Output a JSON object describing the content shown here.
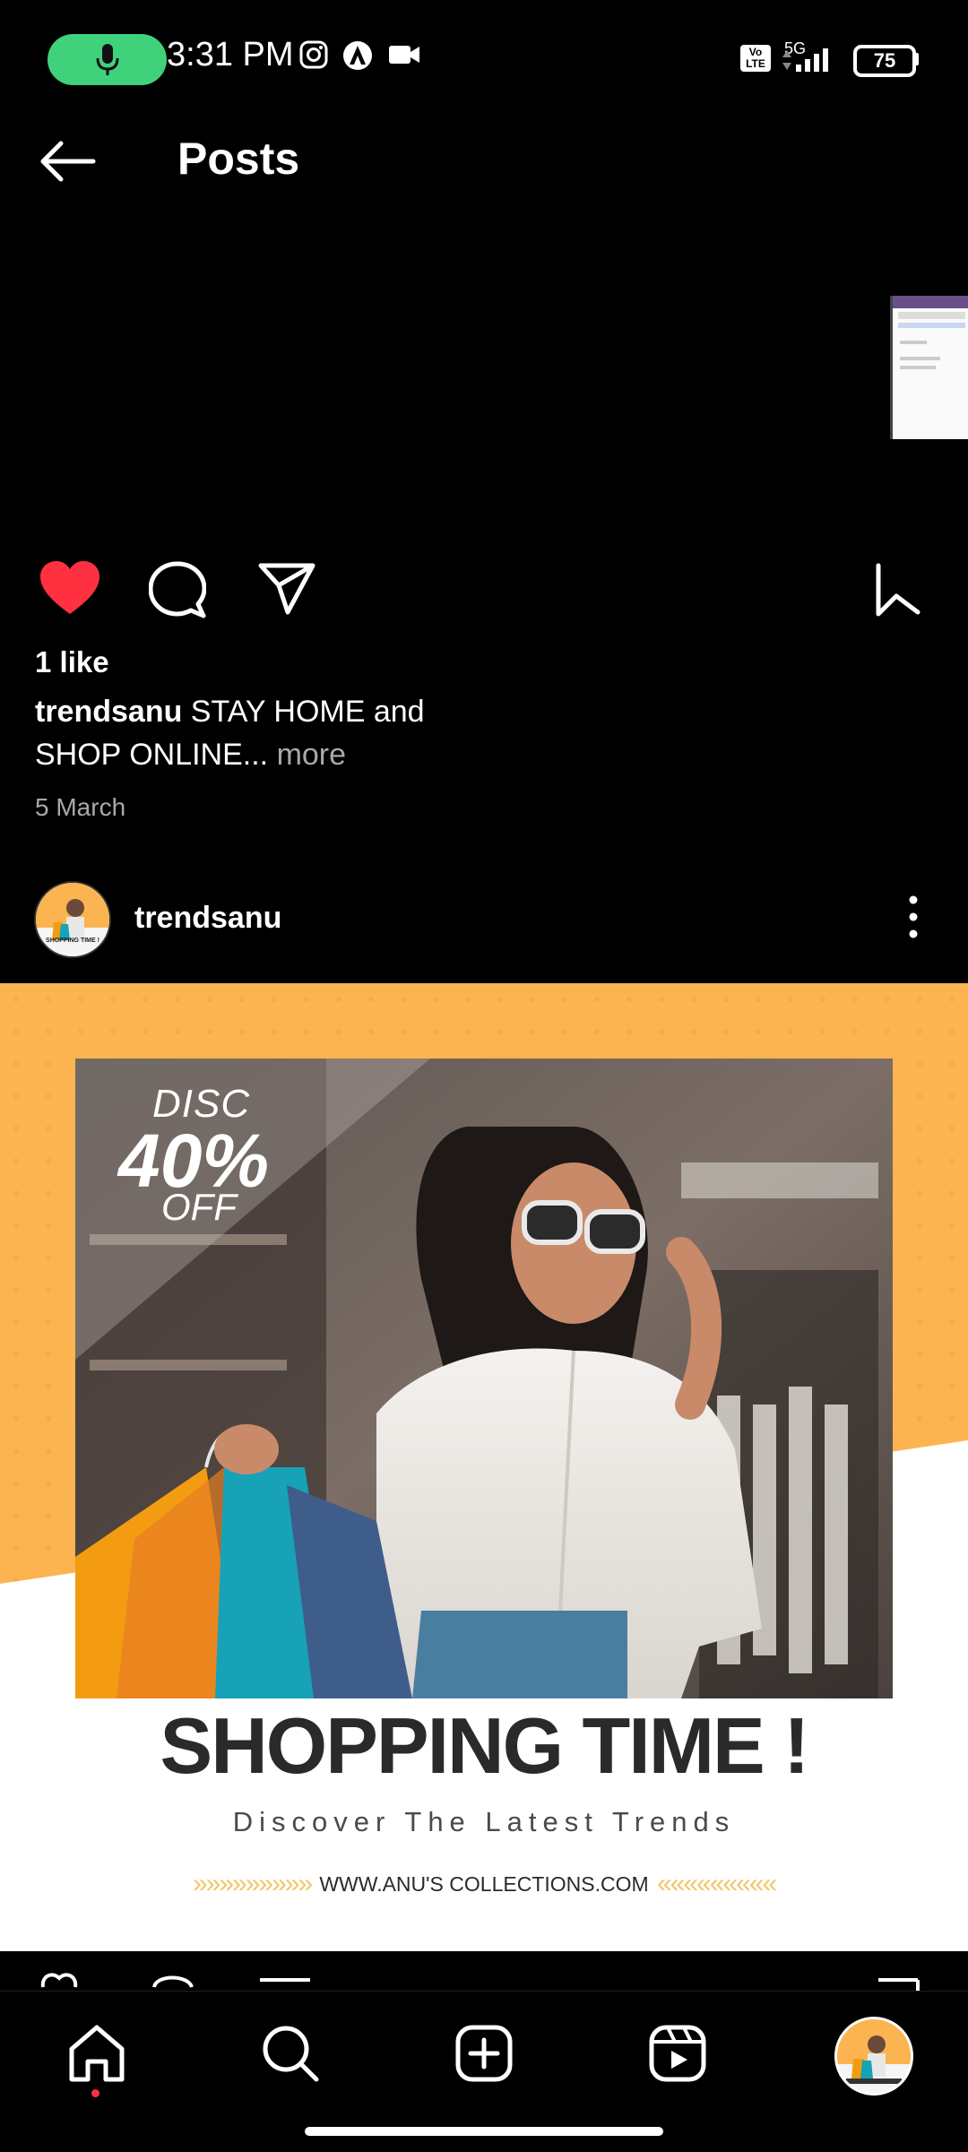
{
  "status_bar": {
    "time": "3:31 PM",
    "network": "5G",
    "volte": "Vo LTE",
    "battery": "75",
    "icons": [
      "mic-icon",
      "instagram-icon",
      "vpn-icon",
      "video-icon",
      "signal-icon",
      "battery-icon"
    ]
  },
  "header": {
    "title": "Posts",
    "back_icon": "back-arrow-icon"
  },
  "post_prev": {
    "likes": "1 like",
    "caption_user": "trendsanu",
    "caption_text": " STAY HOME and SHOP ONLINE...",
    "more_label": " more",
    "date": "5 March",
    "liked": true
  },
  "post": {
    "username": "trendsanu",
    "avatar_caption": "SHOPPING TIME !",
    "banner": {
      "disc": "DISC",
      "percent": "40%",
      "off": "OFF",
      "headline": "SHOPPING TIME !",
      "subline": "Discover The Latest Trends",
      "chevrons_left": "»»»»»»»»»",
      "website": "WWW.ANU'S COLLECTIONS.COM",
      "chevrons_right": "«««««««««"
    }
  },
  "bottom_nav": {
    "items": [
      "home-icon",
      "search-icon",
      "create-icon",
      "reels-icon",
      "profile-avatar"
    ]
  },
  "colors": {
    "like_red": "#ff3040",
    "banner_orange": "#fbb450",
    "mic_green": "#3fd27b"
  }
}
